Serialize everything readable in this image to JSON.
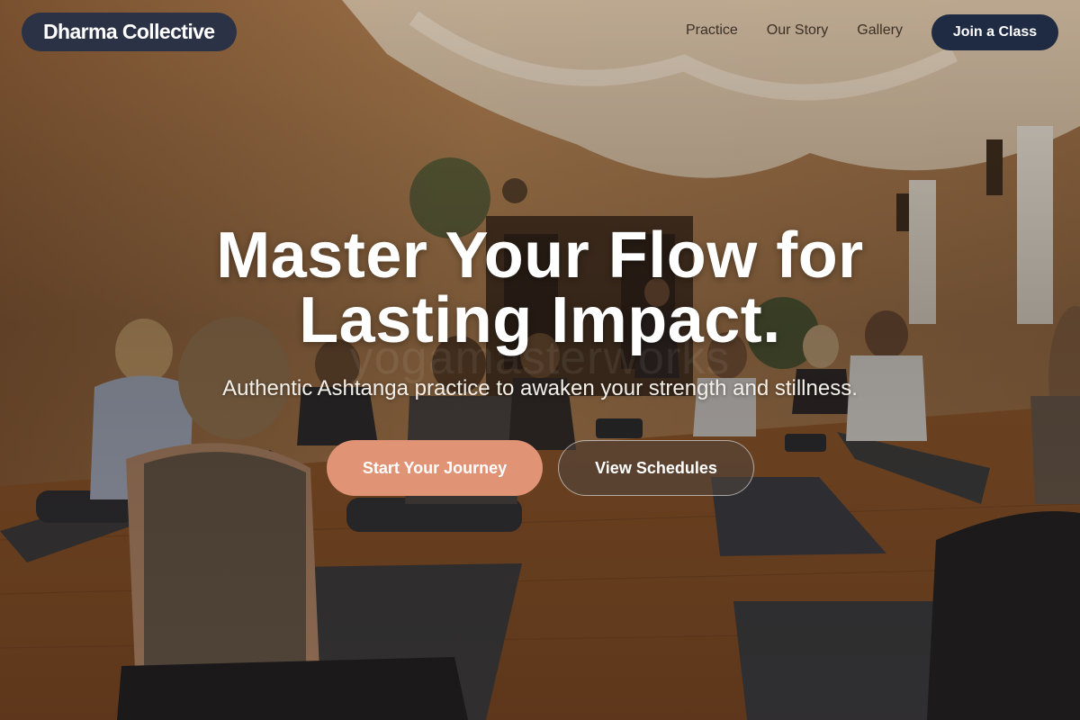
{
  "nav": {
    "brand": "Dharma Collective",
    "links": [
      "Practice",
      "Our Story",
      "Gallery"
    ],
    "cta": "Join a Class"
  },
  "hero": {
    "headline_line1": "Master Your Flow for",
    "headline_line2": "Lasting Impact.",
    "watermark": "yogamasterworks",
    "subtitle": "Authentic Ashtanga practice to awaken your strength and stillness.",
    "primary_button": "Start Your Journey",
    "secondary_button": "View Schedules"
  },
  "colors": {
    "brand_pill": "#2b3245",
    "cta_pill": "#1e2b42",
    "primary_button": "#e09375"
  },
  "background_image": "yoga studio class with students seated on mats"
}
